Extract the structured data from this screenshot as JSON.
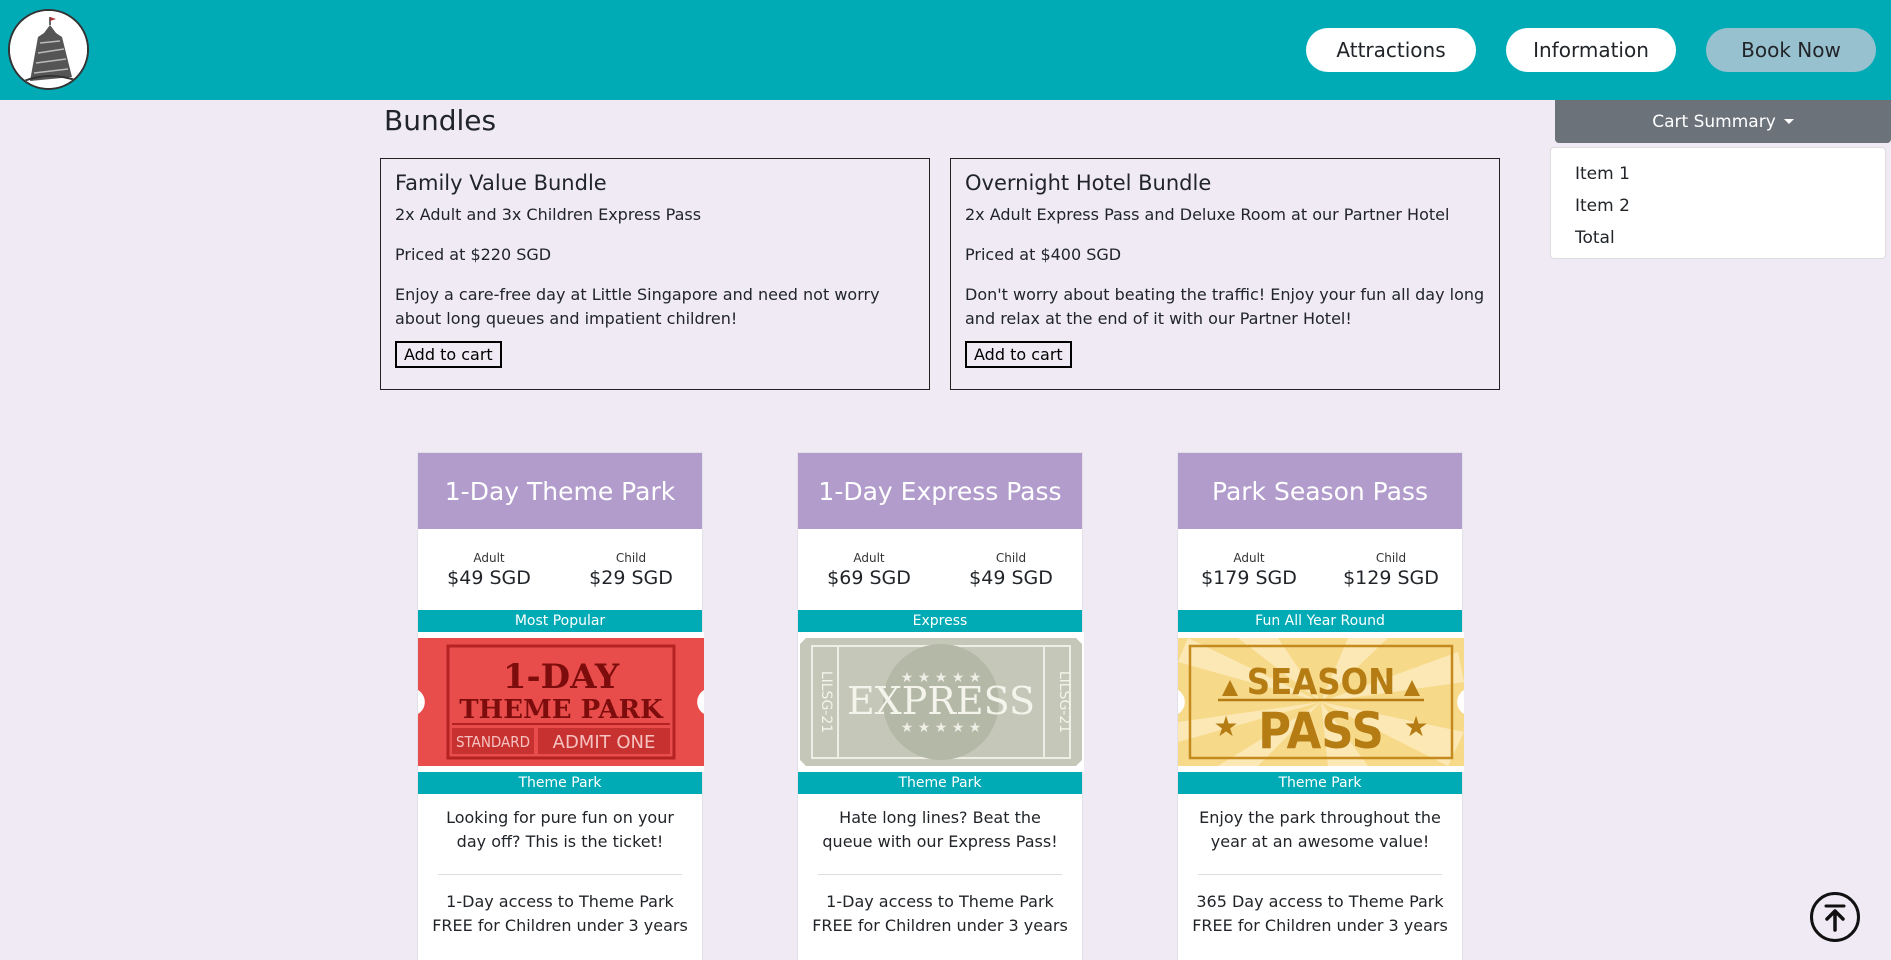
{
  "nav": {
    "logo_alt": "Little Singapore logo",
    "attractions": "Attractions",
    "information": "Information",
    "book_now": "Book Now"
  },
  "bundles": {
    "title": "Bundles",
    "items": [
      {
        "name": "Family Value Bundle",
        "contents": "2x Adult and 3x Children Express Pass",
        "price": "Priced at $220 SGD",
        "description": "Enjoy a care-free day at Little Singapore and need not worry about long queues and impatient children!",
        "button": "Add to cart"
      },
      {
        "name": "Overnight Hotel Bundle",
        "contents": "2x Adult Express Pass and Deluxe Room at our Partner Hotel",
        "price": "Priced at $400 SGD",
        "description": "Don't worry about beating the traffic! Enjoy your fun all day long and relax at the end of it with our Partner Hotel!",
        "button": "Add to cart"
      }
    ]
  },
  "cart": {
    "toggle": "Cart Summary",
    "items": [
      "Item 1",
      "Item 2",
      "Total"
    ]
  },
  "tickets": [
    {
      "title": "1-Day Theme Park",
      "adult_label": "Adult",
      "adult_price": "$49 SGD",
      "child_label": "Child",
      "child_price": "$29 SGD",
      "tag": "Most Popular",
      "art_line1": "1-DAY",
      "art_line2": "THEME PARK",
      "art_left": "STANDARD",
      "art_right": "ADMIT ONE",
      "category": "Theme Park",
      "description": "Looking for pure fun on your day off? This is the ticket!",
      "feature_1": "1-Day access to Theme Park",
      "feature_2": "FREE for Children under 3 years"
    },
    {
      "title": "1-Day Express Pass",
      "adult_label": "Adult",
      "adult_price": "$69 SGD",
      "child_label": "Child",
      "child_price": "$49 SGD",
      "tag": "Express",
      "art_main": "EXPRESS",
      "art_side": "LILSG-21",
      "category": "Theme Park",
      "description": "Hate long lines? Beat the queue with our Express Pass!",
      "feature_1": "1-Day access to Theme Park",
      "feature_2": "FREE for Children under 3 years"
    },
    {
      "title": "Park Season Pass",
      "adult_label": "Adult",
      "adult_price": "$179 SGD",
      "child_label": "Child",
      "child_price": "$129 SGD",
      "tag": "Fun All Year Round",
      "art_line1": "SEASON",
      "art_line2": "PASS",
      "category": "Theme Park",
      "description": "Enjoy the park throughout the year at an awesome value!",
      "feature_1": "365 Day access to Theme Park",
      "feature_2": "FREE for Children under 3 years"
    }
  ],
  "colors": {
    "header": "#00abb5",
    "page_bg": "#efeaf4",
    "card_head": "#b19ccc",
    "cart_toggle": "#6c727a",
    "book_now": "#98c1cf"
  },
  "icons": {
    "back_to_top": "arrow-up-circle-icon"
  }
}
